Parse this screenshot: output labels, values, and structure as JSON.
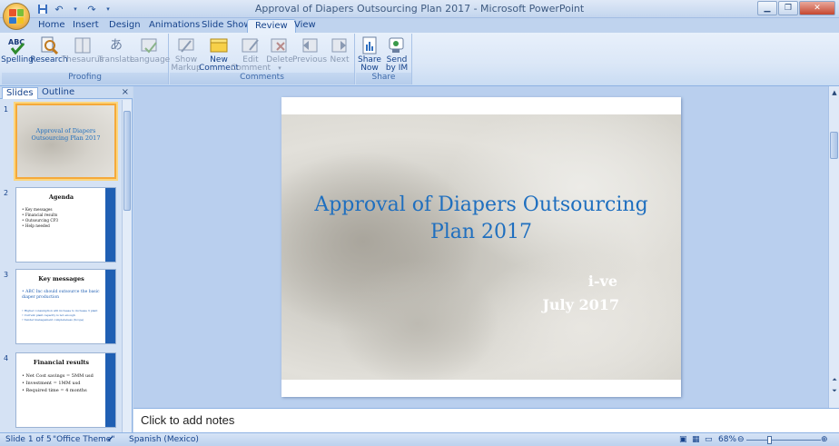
{
  "window": {
    "title": "Approval of Diapers Outsourcing Plan 2017 - Microsoft PowerPoint"
  },
  "tabs": [
    {
      "label": "Home"
    },
    {
      "label": "Insert"
    },
    {
      "label": "Design"
    },
    {
      "label": "Animations"
    },
    {
      "label": "Slide Show"
    },
    {
      "label": "Review"
    },
    {
      "label": "View"
    }
  ],
  "active_tab": "Review",
  "ribbon": {
    "proofing": {
      "label": "Proofing",
      "buttons": [
        {
          "label": "Spelling",
          "icon": "spelling-icon"
        },
        {
          "label": "Research",
          "icon": "research-icon"
        },
        {
          "label": "Thesaurus",
          "icon": "thesaurus-icon"
        },
        {
          "label": "Translate",
          "icon": "translate-icon"
        },
        {
          "label": "Language",
          "icon": "language-icon"
        }
      ]
    },
    "comments": {
      "label": "Comments",
      "buttons": [
        {
          "label1": "Show",
          "label2": "Markup",
          "icon": "show-markup-icon"
        },
        {
          "label1": "New",
          "label2": "Comment",
          "icon": "new-comment-icon"
        },
        {
          "label1": "Edit",
          "label2": "Comment",
          "icon": "edit-comment-icon"
        },
        {
          "label1": "Delete",
          "label2": "",
          "icon": "delete-comment-icon"
        },
        {
          "label1": "Previous",
          "label2": "",
          "icon": "previous-icon"
        },
        {
          "label1": "Next",
          "label2": "",
          "icon": "next-icon"
        }
      ]
    },
    "share": {
      "label": "Share",
      "buttons": [
        {
          "label1": "Share",
          "label2": "Now",
          "icon": "share-now-icon"
        },
        {
          "label1": "Send",
          "label2": "by IM",
          "icon": "send-im-icon"
        }
      ]
    }
  },
  "left_pane": {
    "tabs": [
      "Slides",
      "Outline"
    ],
    "close": "×",
    "slides": [
      {
        "num": "1",
        "title": "Approval of Diapers Outsourcing Plan 2017"
      },
      {
        "num": "2",
        "title": "Agenda",
        "items": [
          "Key messages",
          "Financial results",
          "Outsourcing CP3",
          "Help needed"
        ]
      },
      {
        "num": "3",
        "title": "Key messages",
        "items": [
          "ABC Inc should outsource the basic diaper production",
          "Higher consumption will increase to increase 3 plant",
          "Current plant capacity is not enough",
          "Tender management completeness (Scope)"
        ]
      },
      {
        "num": "4",
        "title": "Financial results",
        "items": [
          "Net Cost savings = 5MM usd",
          "Investment = 1MM usd",
          "Required time = 4 months"
        ]
      }
    ]
  },
  "slide": {
    "title": "Approval of Diapers Outsourcing Plan 2017",
    "subtitle1": "i-ve",
    "subtitle2": "July 2017"
  },
  "notes": {
    "placeholder": "Click to add notes"
  },
  "status": {
    "slide_info": "Slide 1 of 5",
    "theme": "\"Office Theme\"",
    "language": "Spanish (Mexico)",
    "zoom": "68%"
  }
}
